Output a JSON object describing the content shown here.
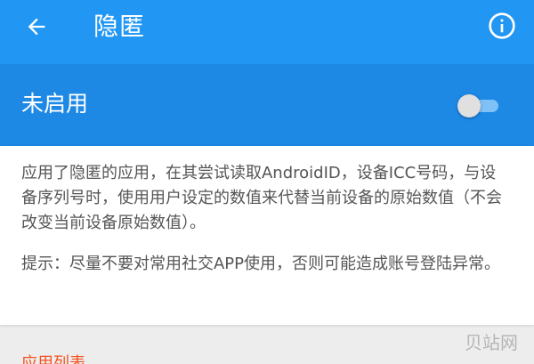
{
  "app_bar": {
    "title": "隐匿",
    "back_icon": "arrow-left-icon",
    "info_icon": "info-circle-icon",
    "background": "#2196f3"
  },
  "master_switch": {
    "label": "未启用",
    "enabled": false,
    "background": "#1e88e5"
  },
  "description": {
    "text": "应用了隐匿的应用，在其尝试读取AndroidID，设备ICC号码，与设备序列号时，使用用户设定的数值来代替当前设备的原始数值（不会改变当前设备原始数值）。",
    "hint": "提示：尽量不要对常用社交APP使用，否则可能造成账号登陆异常。"
  },
  "section": {
    "header": "应用列表",
    "color": "#f4511e"
  },
  "watermark": {
    "text": "贝站网"
  }
}
